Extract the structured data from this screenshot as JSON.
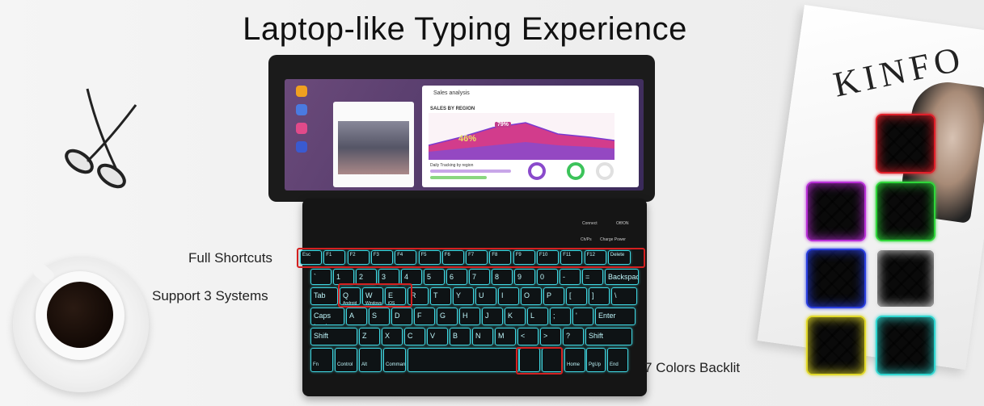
{
  "headline": "Laptop-like Typing  Experience",
  "callouts": {
    "full_shortcuts": "Full Shortcuts",
    "support_systems": "Support 3 Systems",
    "colors_backlit": "7 Colors Backlit"
  },
  "magazine_title": "KINFO",
  "tablet_screen": {
    "app_title": "Sales analysis",
    "chart_title": "SALES BY REGION",
    "value_badge": "79%",
    "value_overlay": "46%",
    "tracking_label": "Daily Tracking by region"
  },
  "keyboard": {
    "system_labels": [
      "Android",
      "Windows",
      "iOS"
    ],
    "switch_labels": [
      "Connect",
      "Off/ON"
    ],
    "mode_labels": [
      "Ch/Ps",
      "Charge Power"
    ],
    "function_keys": [
      "Esc",
      "F1",
      "F2",
      "F3",
      "F4",
      "F5",
      "F6",
      "F7",
      "F8",
      "F9",
      "F10",
      "F11",
      "F12",
      "Delete"
    ],
    "number_row": [
      "`",
      "1",
      "2",
      "3",
      "4",
      "5",
      "6",
      "7",
      "8",
      "9",
      "0",
      "-",
      "=",
      "Backspace"
    ],
    "row_q": [
      "Tab",
      "Q",
      "W",
      "E",
      "R",
      "T",
      "Y",
      "U",
      "I",
      "O",
      "P",
      "[",
      "]",
      "\\"
    ],
    "row_a": [
      "Caps Lock",
      "A",
      "S",
      "D",
      "F",
      "G",
      "H",
      "J",
      "K",
      "L",
      ";",
      "'",
      "Enter"
    ],
    "row_z": [
      "Shift",
      "Z",
      "X",
      "C",
      "V",
      "B",
      "N",
      "M",
      "<",
      ">",
      "?",
      "Shift"
    ],
    "row_bottom": [
      "Fn",
      "Control",
      "Alt",
      "Command",
      "",
      "",
      "",
      "Home",
      "PgUp",
      "End"
    ]
  },
  "backlight_colors": [
    "#e0202a",
    "#b82fd6",
    "#2fd63a",
    "#2a3fe0",
    "#e8e8e8",
    "#e0d82a",
    "#2fd6d0"
  ],
  "key_glow_color": "#3fd5e0"
}
